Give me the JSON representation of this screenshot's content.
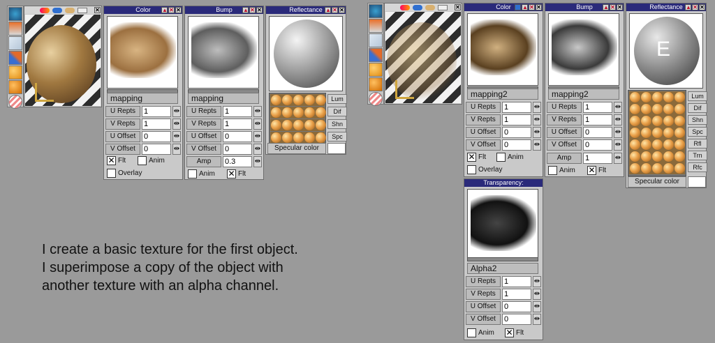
{
  "left_preview": {
    "header_icons": [
      "color-orb-icon",
      "pill-icon",
      "texture-icon",
      "link-icon"
    ],
    "tools": [
      "globe-icon",
      "lamp-icon",
      "image-icon",
      "brush-icon",
      "orange-sphere-icon",
      "orange-sphere-icon",
      "striped-ball-icon"
    ]
  },
  "left_color": {
    "title": "Color",
    "mapping": "mapping",
    "rows": [
      {
        "label": "U Repts",
        "value": "1"
      },
      {
        "label": "V Repts",
        "value": "1"
      },
      {
        "label": "U Offset",
        "value": "0"
      },
      {
        "label": "V Offset",
        "value": "0"
      }
    ],
    "flt_label": "Flt",
    "anim_label": "Anim",
    "overlay_label": "Overlay"
  },
  "left_bump": {
    "title": "Bump",
    "mapping": "mapping",
    "rows": [
      {
        "label": "U Repts",
        "value": "1"
      },
      {
        "label": "V Repts",
        "value": "1"
      },
      {
        "label": "U Offset",
        "value": "0"
      },
      {
        "label": "V Offset",
        "value": "0"
      },
      {
        "label": "Amp",
        "value": "0.3"
      }
    ],
    "anim_label": "Anim",
    "flt_label": "Flt"
  },
  "left_refl": {
    "title": "Reflectance",
    "buttons": [
      "Lum",
      "Dif",
      "Shn",
      "Spc"
    ],
    "specular_label": "Specular color"
  },
  "right_color": {
    "title": "Color",
    "mapping": "mapping2",
    "rows": [
      {
        "label": "U Repts",
        "value": "1"
      },
      {
        "label": "V Repts",
        "value": "1"
      },
      {
        "label": "U Offset",
        "value": "0"
      },
      {
        "label": "V Offset",
        "value": "0"
      }
    ],
    "flt_label": "Flt",
    "anim_label": "Anim",
    "overlay_label": "Overlay"
  },
  "right_bump": {
    "title": "Bump",
    "mapping": "mapping2",
    "rows": [
      {
        "label": "U Repts",
        "value": "1"
      },
      {
        "label": "V Repts",
        "value": "1"
      },
      {
        "label": "U Offset",
        "value": "0"
      },
      {
        "label": "V Offset",
        "value": "0"
      },
      {
        "label": "Amp",
        "value": "1"
      }
    ],
    "anim_label": "Anim",
    "flt_label": "Flt"
  },
  "right_refl": {
    "title": "Reflectance",
    "sphere_letter": "E",
    "buttons": [
      "Lum",
      "Dif",
      "Shn",
      "Spc",
      "Rfl",
      "Trn",
      "Rfc"
    ],
    "specular_label": "Specular color"
  },
  "transparency": {
    "title": "Transparency:",
    "mapping": "Alpha2",
    "rows": [
      {
        "label": "U Repts",
        "value": "1"
      },
      {
        "label": "V Repts",
        "value": "1"
      },
      {
        "label": "U Offset",
        "value": "0"
      },
      {
        "label": "V Offset",
        "value": "0"
      }
    ],
    "anim_label": "Anim",
    "flt_label": "Flt"
  },
  "caption": {
    "line1": "I create a basic texture for the first object.",
    "line2": "I superimpose a copy of the object with",
    "line3": "another texture with an alpha channel."
  },
  "colors": {
    "background": "#9a9a9a",
    "panel": "#c9c9c9",
    "title_bar": "#2a2a7a",
    "close_red": "#c0102a"
  }
}
